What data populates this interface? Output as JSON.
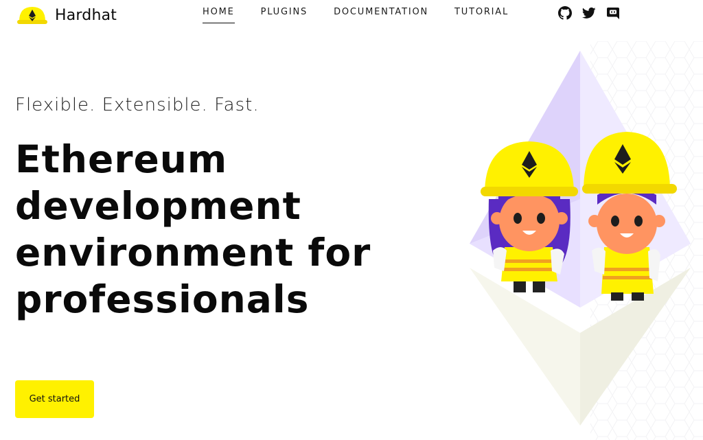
{
  "header": {
    "logo_text": "Hardhat",
    "nav": [
      {
        "label": "HOME",
        "active": true
      },
      {
        "label": "PLUGINS",
        "active": false
      },
      {
        "label": "DOCUMENTATION",
        "active": false
      },
      {
        "label": "TUTORIAL",
        "active": false
      }
    ],
    "social_icons": [
      "github-icon",
      "twitter-icon",
      "discord-icon"
    ]
  },
  "hero": {
    "tagline": "Flexible. Extensible. Fast.",
    "headline_lines": [
      "Ethereum",
      "development",
      "environment for",
      "professionals"
    ],
    "cta_label": "Get started"
  },
  "colors": {
    "accent_yellow": "#fff100",
    "text": "#0a0a0a",
    "background": "#ffffff",
    "diamond_purple": "#e6dcff"
  }
}
